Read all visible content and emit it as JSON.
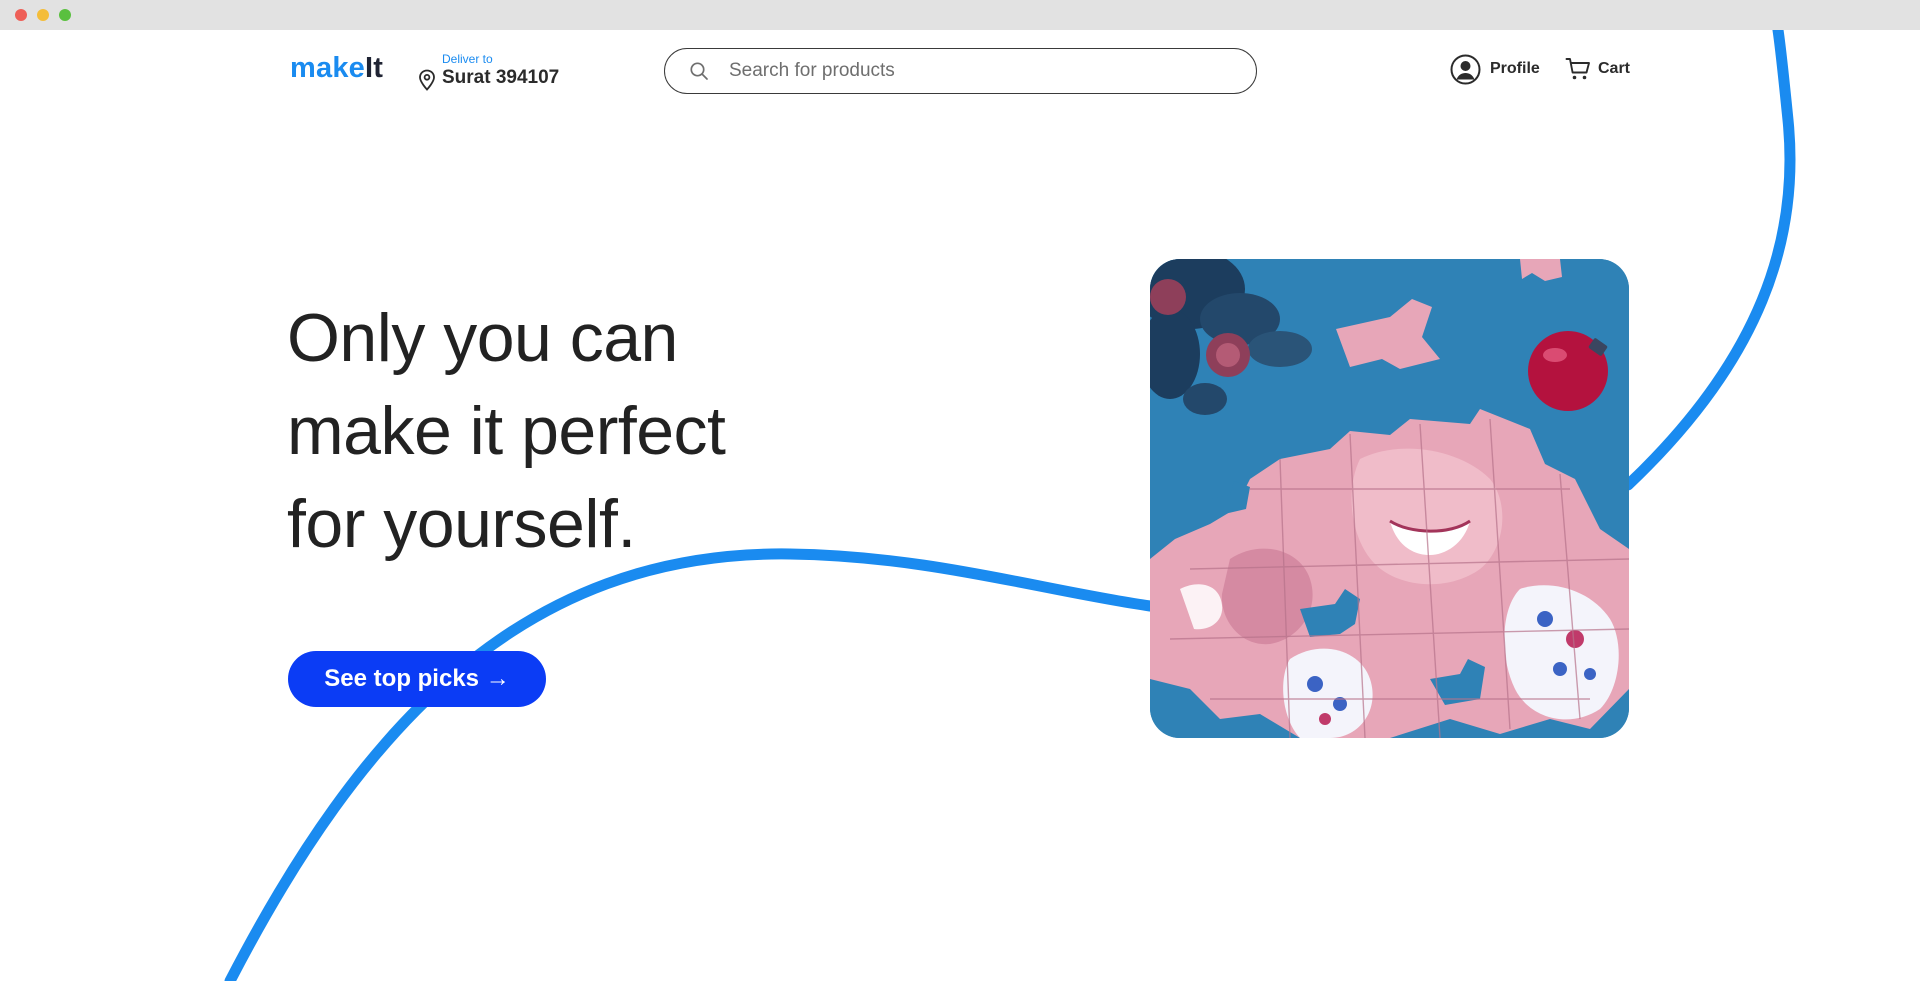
{
  "brand": {
    "part1": "make",
    "part2": "It"
  },
  "location": {
    "label": "Deliver to",
    "city": "Surat 394107",
    "icon": "location-pin-icon"
  },
  "search": {
    "placeholder": "Search for products",
    "value": "",
    "icon": "search-icon"
  },
  "nav": {
    "profile_label": "Profile",
    "profile_icon": "user-circle-icon",
    "cart_label": "Cart",
    "cart_icon": "shopping-cart-icon"
  },
  "hero": {
    "headline_lines": [
      "Only you can",
      "make it perfect",
      "for yourself."
    ],
    "cta_label": "See top picks →"
  },
  "colors": {
    "brand_blue": "#1a8bf0",
    "cta_blue": "#0b3cf5",
    "curve_blue": "#1a8bf0",
    "image_bg": "#2f82b6",
    "puzzle_pink": "#e7a6b8"
  }
}
